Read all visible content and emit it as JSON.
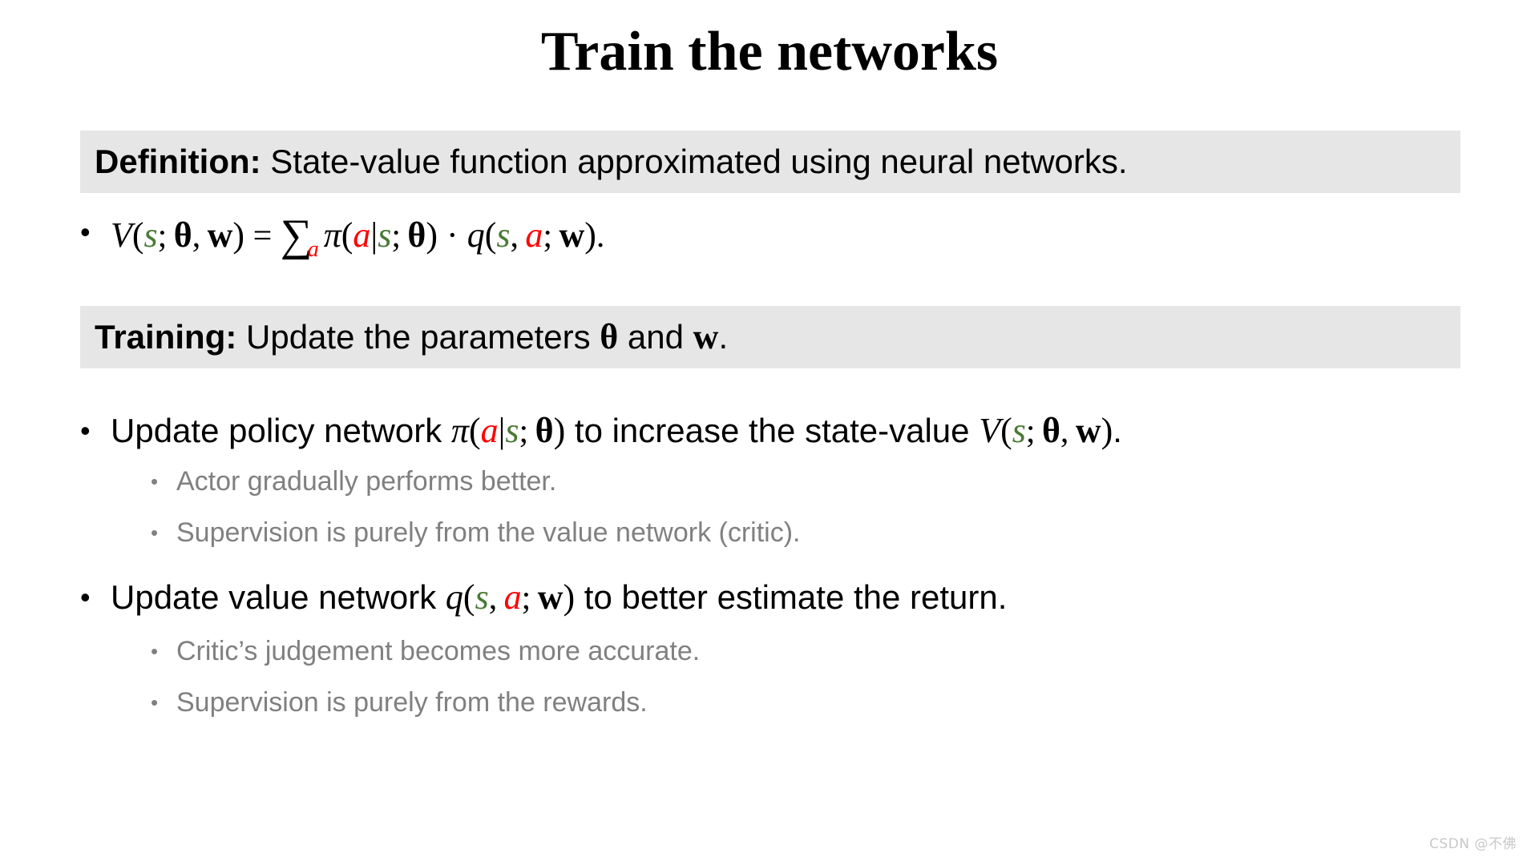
{
  "slide": {
    "title": "Train the networks",
    "background_color": "#ffffff",
    "banner_color": "#e6e6e6",
    "accent_colors": {
      "state_variable_green": "#4a7a35",
      "action_variable_red": "#ff0000",
      "subbullet_gray": "#808080"
    }
  },
  "definition_banner": {
    "label": "Definition:",
    "text": " State-value function approximated using neural networks."
  },
  "definition_formula": {
    "bullet": "•",
    "plain_text": "V(s; θ, w) = ∑ₐ π(a|s; θ) · q(s, a; w).",
    "parts": {
      "V": "V",
      "open1": "(",
      "s1": "s",
      "semicolon1": "; ",
      "theta1": "θ",
      "comma1": ", ",
      "w1": "w",
      "close1": ")",
      "equals": " = ",
      "sum": "∑",
      "sum_subscript": "a",
      "pi": "π",
      "open2": "(",
      "a1": "a",
      "bar": "|",
      "s2": "s",
      "semicolon2": "; ",
      "theta2": "θ",
      "close2": ")",
      "cdot": " · ",
      "q": "q",
      "open3": "(",
      "s3": "s",
      "comma2": ", ",
      "a2": "a",
      "semicolon3": "; ",
      "w2": "w",
      "close3": ")",
      "period": "."
    }
  },
  "training_banner": {
    "label": "Training:",
    "text_before_theta": " Update the parameters ",
    "theta": "θ",
    "text_between": " and ",
    "w": "w",
    "period": "."
  },
  "bullets": [
    {
      "bullet": "•",
      "text_before": "Update policy network ",
      "math_pi": "π",
      "open1": "(",
      "a": "a",
      "bar": "|",
      "s": "s",
      "semicolon1": "; ",
      "theta": "θ",
      "close1": ")",
      "text_middle": " to increase the state-value ",
      "math_V": "V",
      "open2": "(",
      "s2": "s",
      "semicolon2": "; ",
      "theta2": "θ",
      "comma": ", ",
      "w": "w",
      "close2": ")",
      "period": ".",
      "plain_text": "Update policy network π(a|s; θ) to increase the state-value V(s; θ, w).",
      "subbullets": [
        {
          "bullet": "•",
          "text": "Actor gradually performs better."
        },
        {
          "bullet": "•",
          "text": "Supervision is purely from the value network (critic)."
        }
      ]
    },
    {
      "bullet": "•",
      "text_before": "Update value network ",
      "math_q": "q",
      "open1": "(",
      "s": "s",
      "comma": ", ",
      "a": "a",
      "semicolon1": "; ",
      "w": "w",
      "close1": ")",
      "text_after": " to better estimate the return.",
      "plain_text": "Update value network q(s, a; w) to better estimate the return.",
      "subbullets": [
        {
          "bullet": "•",
          "text": "Critic’s judgement becomes more accurate."
        },
        {
          "bullet": "•",
          "text": "Supervision is purely from the rewards."
        }
      ]
    }
  ],
  "watermark": {
    "text": "CSDN @不佛"
  }
}
